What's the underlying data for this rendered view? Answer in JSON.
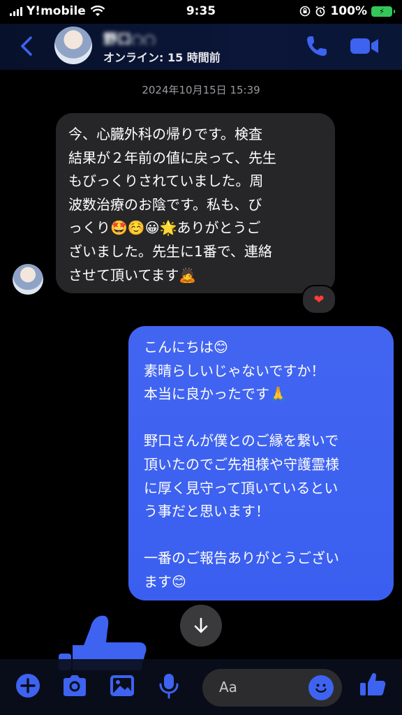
{
  "status_bar": {
    "carrier": "Y!mobile",
    "time": "9:35",
    "battery": "100%"
  },
  "header": {
    "contact_name": "野口○○",
    "contact_status": "オンライン: 15 時間前"
  },
  "thread": {
    "timestamp": "2024年10月15日 15:39",
    "incoming": {
      "text": "今、心臓外科の帰りです。検査\n結果が２年前の値に戻って、先生\nもびっくりされていました。周\n波数治療のお陰です。私も、び\nっくり🤩☺️😀🌟ありがとうご\nざいました。先生に1番で、連絡\nさせて頂いてます🙇",
      "reaction": "❤"
    },
    "outgoing": {
      "text": "こんにちは😊\n素晴らしいじゃないですか！\n本当に良かったです🙏\n\n野口さんが僕とのご縁を繋いで\n頂いたのでご先祖様や守護霊様\nに厚く見守って頂いているとい\nう事だと思います！\n\n一番のご報告ありがとうござい\nます😊"
    }
  },
  "composer": {
    "placeholder": "Aa"
  },
  "colors": {
    "accent": "#3d63f0",
    "bubble_in": "#262628",
    "bubble_out": "#4265f1"
  },
  "icons": [
    "back-icon",
    "phone-icon",
    "video-icon",
    "arrow-down-icon",
    "plus-icon",
    "camera-icon",
    "photo-icon",
    "mic-icon",
    "emoji-icon",
    "thumbs-up-icon"
  ]
}
